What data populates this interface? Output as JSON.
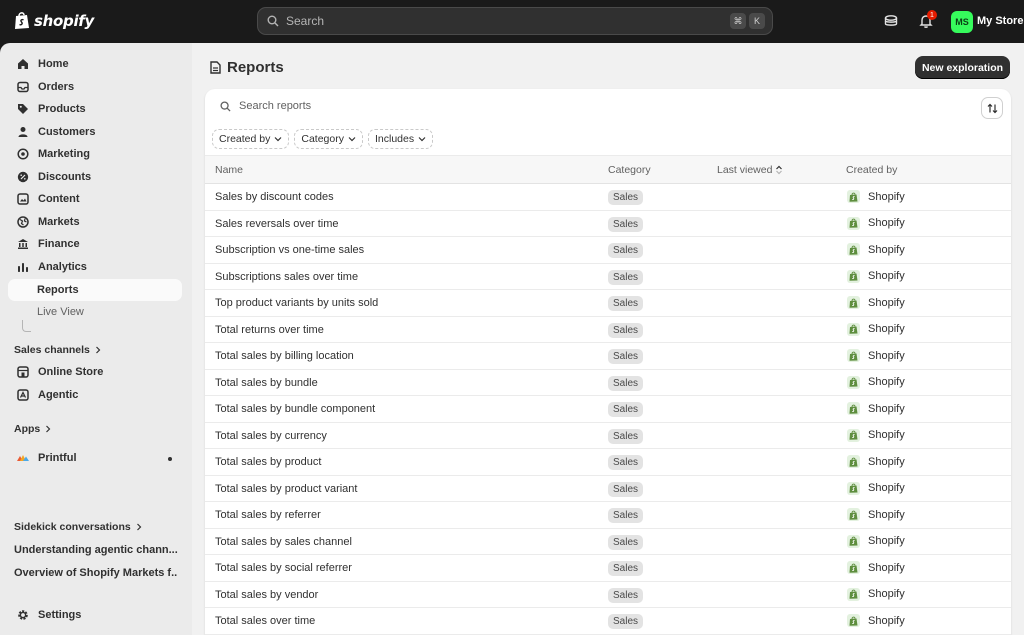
{
  "topbar": {
    "logo_text": "shopify",
    "search_placeholder": "Search",
    "shortcut_cmd": "⌘",
    "shortcut_key": "K",
    "notification_count": "1",
    "avatar_initials": "MS",
    "store_name": "My Store"
  },
  "sidebar": {
    "nav": [
      {
        "label": "Home",
        "icon": "home-icon"
      },
      {
        "label": "Orders",
        "icon": "inbox-icon"
      },
      {
        "label": "Products",
        "icon": "tag-icon"
      },
      {
        "label": "Customers",
        "icon": "person-icon"
      },
      {
        "label": "Marketing",
        "icon": "target-icon"
      },
      {
        "label": "Discounts",
        "icon": "discount-icon"
      },
      {
        "label": "Content",
        "icon": "content-icon"
      },
      {
        "label": "Markets",
        "icon": "globe-icon"
      },
      {
        "label": "Finance",
        "icon": "bank-icon"
      },
      {
        "label": "Analytics",
        "icon": "chart-icon"
      }
    ],
    "sub_reports": "Reports",
    "sub_live_view": "Live View",
    "sales_channels_heading": "Sales channels",
    "channels": [
      {
        "label": "Online Store",
        "icon": "store-icon"
      },
      {
        "label": "Agentic",
        "icon": "agentic-icon"
      }
    ],
    "apps_heading": "Apps",
    "apps": [
      {
        "label": "Printful",
        "icon": "printful-icon"
      }
    ],
    "sidekick_heading": "Sidekick conversations",
    "conversations": [
      "Understanding agentic chann...",
      "Overview of Shopify Markets f..."
    ],
    "settings_label": "Settings"
  },
  "page": {
    "title": "Reports",
    "new_button": "New exploration",
    "search_placeholder": "Search reports",
    "filters": [
      "Created by",
      "Category",
      "Includes"
    ],
    "columns": {
      "name": "Name",
      "category": "Category",
      "last_viewed": "Last viewed",
      "created_by": "Created by"
    },
    "rows": [
      {
        "name": "Sales by discount codes",
        "category": "Sales",
        "created_by": "Shopify"
      },
      {
        "name": "Sales reversals over time",
        "category": "Sales",
        "created_by": "Shopify"
      },
      {
        "name": "Subscription vs one-time sales",
        "category": "Sales",
        "created_by": "Shopify"
      },
      {
        "name": "Subscriptions sales over time",
        "category": "Sales",
        "created_by": "Shopify"
      },
      {
        "name": "Top product variants by units sold",
        "category": "Sales",
        "created_by": "Shopify"
      },
      {
        "name": "Total returns over time",
        "category": "Sales",
        "created_by": "Shopify"
      },
      {
        "name": "Total sales by billing location",
        "category": "Sales",
        "created_by": "Shopify"
      },
      {
        "name": "Total sales by bundle",
        "category": "Sales",
        "created_by": "Shopify"
      },
      {
        "name": "Total sales by bundle component",
        "category": "Sales",
        "created_by": "Shopify"
      },
      {
        "name": "Total sales by currency",
        "category": "Sales",
        "created_by": "Shopify"
      },
      {
        "name": "Total sales by product",
        "category": "Sales",
        "created_by": "Shopify"
      },
      {
        "name": "Total sales by product variant",
        "category": "Sales",
        "created_by": "Shopify"
      },
      {
        "name": "Total sales by referrer",
        "category": "Sales",
        "created_by": "Shopify"
      },
      {
        "name": "Total sales by sales channel",
        "category": "Sales",
        "created_by": "Shopify"
      },
      {
        "name": "Total sales by social referrer",
        "category": "Sales",
        "created_by": "Shopify"
      },
      {
        "name": "Total sales by vendor",
        "category": "Sales",
        "created_by": "Shopify"
      },
      {
        "name": "Total sales over time",
        "category": "Sales",
        "created_by": "Shopify"
      }
    ]
  },
  "colors": {
    "topbar": "#1a1a1a",
    "sidebar": "#ebebeb",
    "main": "#f1f1f1",
    "accent_green": "#36fb5c",
    "shopify_green": "#5e8e3e",
    "notification": "#e51c00"
  }
}
